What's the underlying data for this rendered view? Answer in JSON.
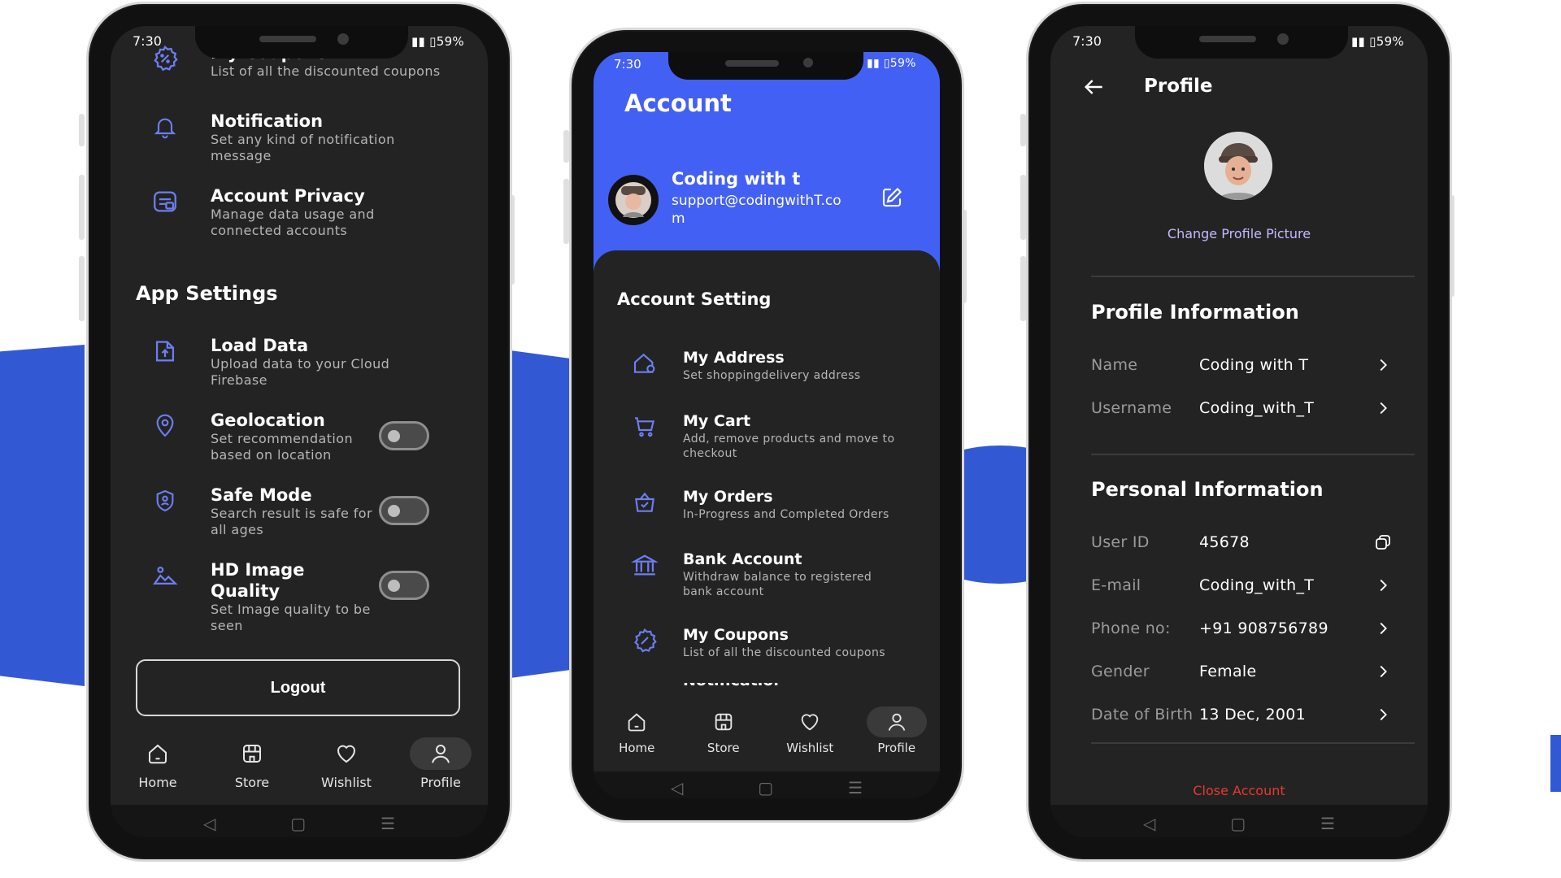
{
  "colors": {
    "brand_blue": "#3358d4",
    "header_blue": "#4360f5",
    "dark_bg": "#232323",
    "accent_icon": "#6d7ef0",
    "danger": "#e53935"
  },
  "status": {
    "time": "7:30",
    "battery": "59%"
  },
  "nav": {
    "home": "Home",
    "store": "Store",
    "wishlist": "Wishlist",
    "profile": "Profile"
  },
  "phone1": {
    "items_top": [
      {
        "title": "My Coupons",
        "subtitle": "List of all the discounted coupons",
        "icon": "coupon-icon"
      },
      {
        "title": "Notification",
        "subtitle": "Set any kind of notification message",
        "icon": "bell-icon"
      },
      {
        "title": "Account Privacy",
        "subtitle": "Manage data usage and connected accounts",
        "icon": "privacy-icon"
      }
    ],
    "app_settings_title": "App Settings",
    "settings": [
      {
        "title": "Load Data",
        "subtitle": "Upload data to your Cloud Firebase",
        "icon": "upload-icon",
        "toggle": null
      },
      {
        "title": "Geolocation",
        "subtitle": "Set recommendation based on location",
        "icon": "location-icon",
        "toggle": false
      },
      {
        "title": "Safe Mode",
        "subtitle": "Search result is safe for all ages",
        "icon": "shield-icon",
        "toggle": false
      },
      {
        "title": "HD Image Quality",
        "subtitle": "Set Image quality to be seen",
        "icon": "image-icon",
        "toggle": false
      }
    ],
    "logout_label": "Logout"
  },
  "phone2": {
    "header_title": "Account",
    "user_name": "Coding with t",
    "user_email": "support@codingwithT.co m",
    "section_title": "Account Setting",
    "items": [
      {
        "title": "My Address",
        "subtitle": "Set shoppingdelivery address",
        "icon": "home-pin-icon"
      },
      {
        "title": "My Cart",
        "subtitle": "Add, remove products and move to checkout",
        "icon": "cart-icon"
      },
      {
        "title": "My Orders",
        "subtitle": "In-Progress and Completed Orders",
        "icon": "bag-icon"
      },
      {
        "title": "Bank Account",
        "subtitle": "Withdraw balance to registered bank account",
        "icon": "bank-icon"
      },
      {
        "title": "My Coupons",
        "subtitle": "List of all the discounted coupons",
        "icon": "coupon-icon"
      },
      {
        "title": "Notification",
        "subtitle": "",
        "icon": "bell-icon"
      }
    ]
  },
  "phone3": {
    "title": "Profile",
    "change_picture": "Change Profile Picture",
    "profile_info_title": "Profile Information",
    "profile_info": [
      {
        "label": "Name",
        "value": "Coding with T",
        "action": "chevron-right-icon"
      },
      {
        "label": "Username",
        "value": "Coding_with_T",
        "action": "chevron-right-icon"
      }
    ],
    "personal_info_title": "Personal Information",
    "personal_info": [
      {
        "label": "User ID",
        "value": "45678",
        "action": "copy-icon"
      },
      {
        "label": "E-mail",
        "value": "Coding_with_T",
        "action": "chevron-right-icon"
      },
      {
        "label": "Phone no:",
        "value": "+91 908756789",
        "action": "chevron-right-icon"
      },
      {
        "label": "Gender",
        "value": "Female",
        "action": "chevron-right-icon"
      },
      {
        "label": "Date of Birth",
        "value": "13 Dec, 2001",
        "action": "chevron-right-icon"
      }
    ],
    "close_account": "Close Account"
  }
}
